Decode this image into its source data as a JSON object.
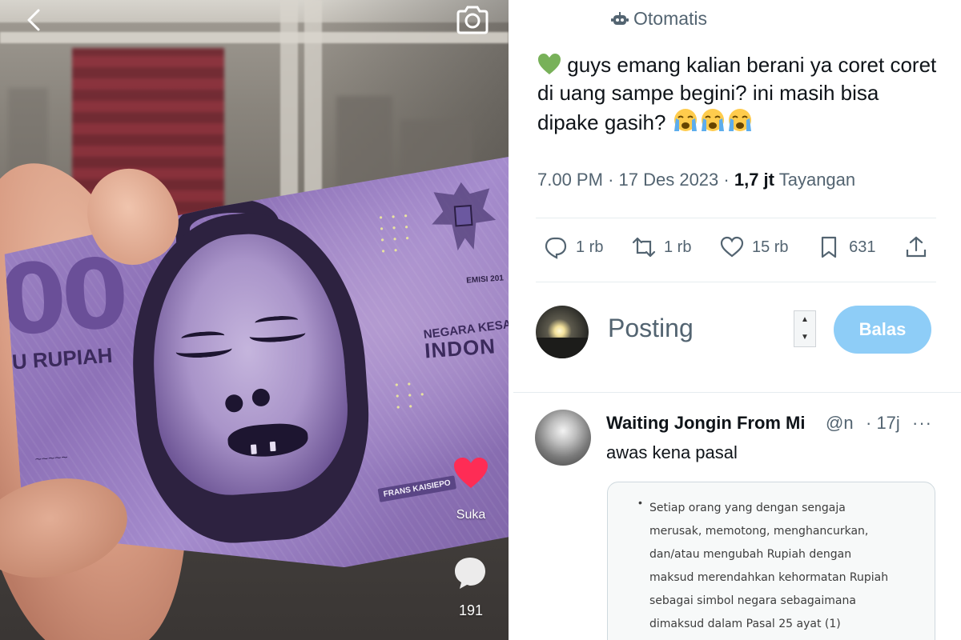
{
  "video": {
    "note_denomination": "00",
    "note_rupiah_text": "U RUPIAH",
    "note_negara_text": "NEGARA KESATUA",
    "note_indon_text": "INDON",
    "note_emisi_text": "EMISI 201",
    "note_portrait_name": "FRANS KAISIEPO",
    "like_label": "Suka",
    "comment_count": "191",
    "like_color": "#fe2c55",
    "icons": [
      "back-chevron-icon",
      "camera-icon",
      "heart-icon",
      "comment-bubble-icon"
    ]
  },
  "tweet": {
    "automated_label": "Otomatis",
    "text": "guys emang kalian berani ya coret coret di uang sampe begini? ini masih bisa dipake gasih?",
    "leading_emoji": "green-heart",
    "trailing_emoji": [
      "loudly-crying-face",
      "loudly-crying-face",
      "loudly-crying-face"
    ],
    "time": "7.00 PM",
    "date": "17 Des 2023",
    "views_count": "1,7 jt",
    "views_label": "Tayangan",
    "separator": "·",
    "actions": {
      "replies": "1 rb",
      "reposts": "1 rb",
      "likes": "15 rb",
      "bookmarks": "631"
    }
  },
  "reply_box": {
    "placeholder": "Posting",
    "button_label": "Balas",
    "button_color": "#8ecdf7"
  },
  "comment": {
    "name": "Waiting Jongin From Mi",
    "handle": "@n",
    "time": "· 17j",
    "more": "···",
    "text": "awas kena pasal",
    "quote_lines": [
      "Setiap orang yang dengan sengaja",
      "merusak, memotong, menghancurkan,",
      "dan/atau mengubah Rupiah dengan",
      "maksud merendahkan kehormatan Rupiah",
      "sebagai simbol negara sebagaimana",
      "dimaksud dalam Pasal 25 ayat (1)"
    ]
  }
}
